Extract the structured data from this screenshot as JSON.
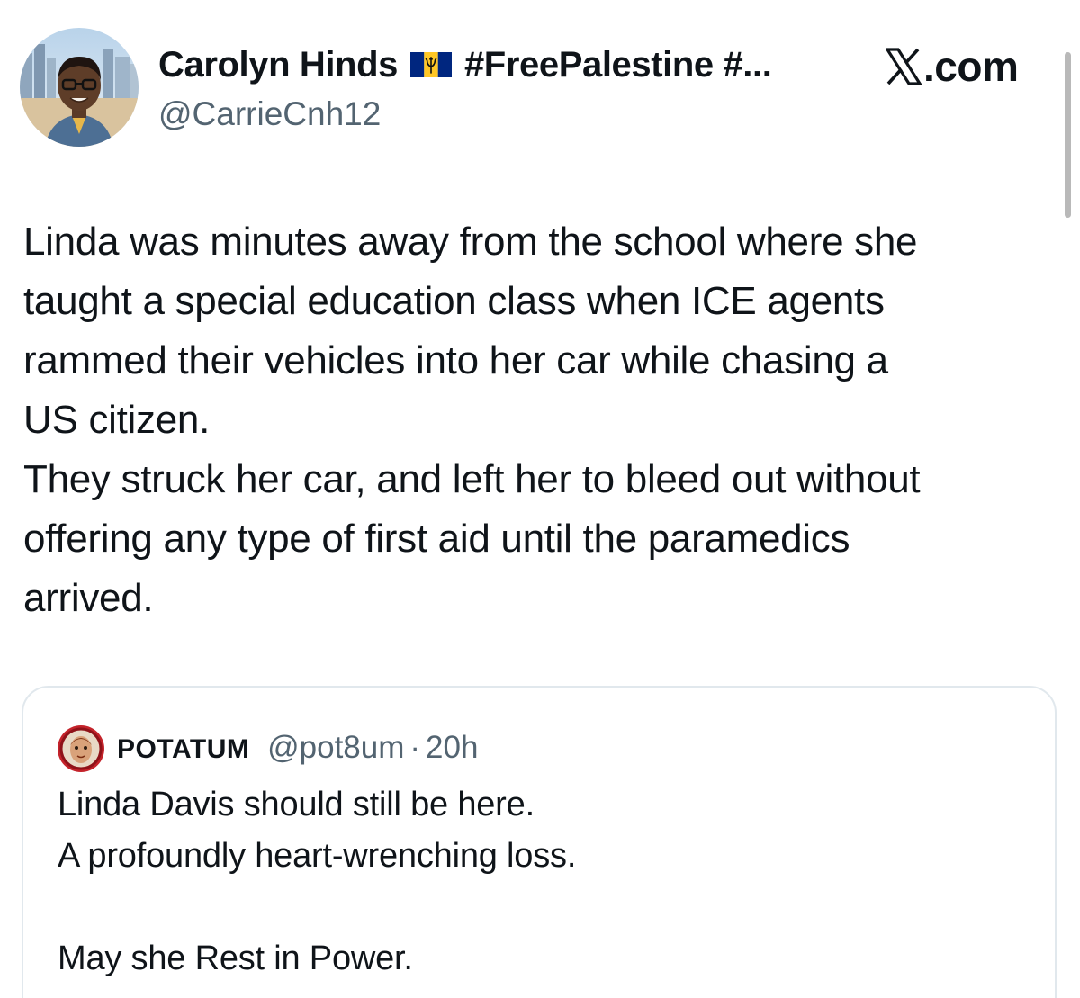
{
  "author": {
    "name": "Carolyn Hinds",
    "hashtags": "#FreePalestine #...",
    "handle": "@CarrieCnh12"
  },
  "site": {
    "logo_suffix": ".com"
  },
  "tweet": {
    "lines": [
      "Linda was minutes away from the school where she",
      "taught a special education class when ICE agents",
      "rammed their vehicles into her car while chasing a",
      "US citizen.",
      "They struck her car, and left her to bleed out without",
      "offering any type of first aid until the paramedics",
      "arrived."
    ]
  },
  "quote": {
    "name": "POTATUM",
    "handle": "@pot8um",
    "separator": "·",
    "time": "20h",
    "lines": [
      "Linda Davis should still be here.",
      "A profoundly heart-wrenching loss.",
      "",
      "May she Rest in Power."
    ]
  },
  "icons": {
    "avatar": "user-photo-avatar",
    "flag": "barbados-flag-icon",
    "logo": "x-logo-icon",
    "quote_avatar": "painted-face-avatar"
  },
  "colors": {
    "text": "#0f1419",
    "secondary": "#536471",
    "border": "#e1e8ed",
    "flag_blue": "#00267f",
    "flag_gold": "#ffc726"
  }
}
